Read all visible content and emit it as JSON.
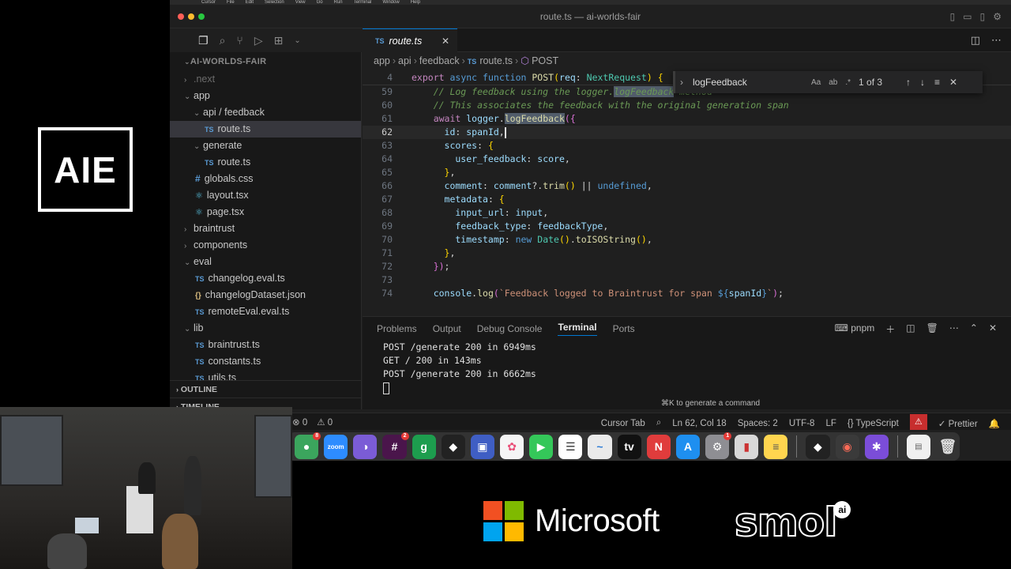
{
  "conference_logo": "AIE",
  "window": {
    "title": "route.ts — ai-worlds-fair"
  },
  "mac_menu": [
    "Cursor",
    "File",
    "Edit",
    "Selection",
    "View",
    "Go",
    "Run",
    "Terminal",
    "Window",
    "Help"
  ],
  "sidebar": {
    "root": "AI-WORLDS-FAIR",
    "items": [
      {
        "label": ".next",
        "type": "folder",
        "indent": 1,
        "open": false,
        "dim": true
      },
      {
        "label": "app",
        "type": "folder",
        "indent": 1,
        "open": true
      },
      {
        "label": "api / feedback",
        "type": "folder",
        "indent": 2,
        "open": true
      },
      {
        "label": "route.ts",
        "type": "ts",
        "indent": 3,
        "selected": true
      },
      {
        "label": "generate",
        "type": "folder",
        "indent": 2,
        "open": true
      },
      {
        "label": "route.ts",
        "type": "ts",
        "indent": 3
      },
      {
        "label": "globals.css",
        "type": "css",
        "indent": 2
      },
      {
        "label": "layout.tsx",
        "type": "react",
        "indent": 2
      },
      {
        "label": "page.tsx",
        "type": "react",
        "indent": 2
      },
      {
        "label": "braintrust",
        "type": "folder",
        "indent": 1,
        "open": false
      },
      {
        "label": "components",
        "type": "folder",
        "indent": 1,
        "open": false
      },
      {
        "label": "eval",
        "type": "folder",
        "indent": 1,
        "open": true
      },
      {
        "label": "changelog.eval.ts",
        "type": "ts",
        "indent": 2
      },
      {
        "label": "changelogDataset.json",
        "type": "json",
        "indent": 2
      },
      {
        "label": "remoteEval.eval.ts",
        "type": "ts",
        "indent": 2
      },
      {
        "label": "lib",
        "type": "folder",
        "indent": 1,
        "open": true
      },
      {
        "label": "braintrust.ts",
        "type": "ts",
        "indent": 2
      },
      {
        "label": "constants.ts",
        "type": "ts",
        "indent": 2
      },
      {
        "label": "utils.ts",
        "type": "ts",
        "indent": 2
      }
    ],
    "outline_label": "OUTLINE",
    "timeline_label": "TIMELINE"
  },
  "editor": {
    "tab_label": "route.ts",
    "breadcrumb": [
      "app",
      "api",
      "feedback",
      "route.ts",
      "POST"
    ],
    "sticky_line": "4",
    "find": {
      "query": "logFeedback",
      "count": "1 of 3"
    },
    "line_numbers": [
      "59",
      "60",
      "61",
      "62",
      "63",
      "64",
      "65",
      "66",
      "67",
      "68",
      "69",
      "70",
      "71",
      "72",
      "73",
      "74"
    ]
  },
  "panel": {
    "tabs": [
      "Problems",
      "Output",
      "Debug Console",
      "Terminal",
      "Ports"
    ],
    "active_tab": "Terminal",
    "shell": "pnpm",
    "terminal_lines": [
      "POST /generate 200 in 6949ms",
      "GET / 200 in 143ms",
      "POST /generate 200 in 6662ms"
    ],
    "hint": "⌘K to generate a command"
  },
  "statusbar": {
    "errors": "0",
    "warnings": "0",
    "cursor_tab": "Cursor Tab",
    "position": "Ln 62, Col 18",
    "spaces": "Spaces: 2",
    "encoding": "UTF-8",
    "eol": "LF",
    "language": "TypeScript",
    "prettier": "Prettier"
  },
  "dock": {
    "badges": {
      "slack": "8",
      "teams": "2",
      "settings": "1"
    },
    "zoom_label": "zoom"
  },
  "sponsors": {
    "microsoft": "Microsoft",
    "smol": "smol",
    "smol_ai": "ai"
  },
  "colors": {
    "accent": "#0078d4",
    "editor_bg": "#1f1f1f",
    "sidebar_bg": "#181818"
  }
}
